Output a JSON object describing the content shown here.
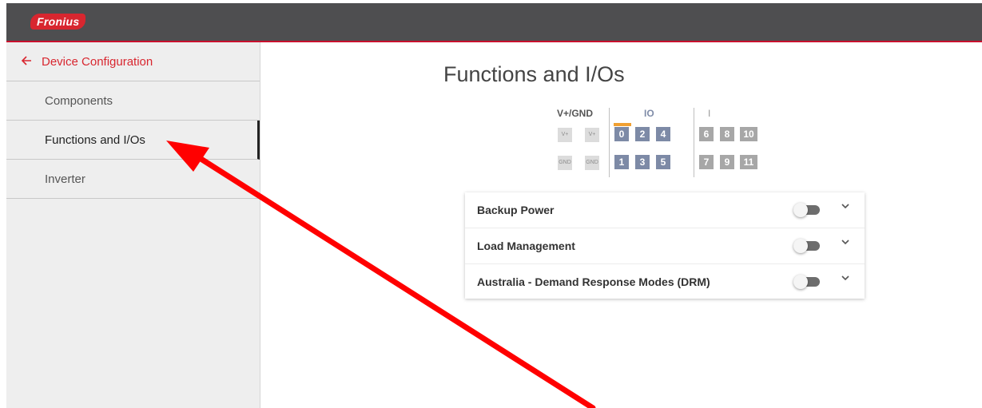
{
  "header": {
    "logo_text": "Fronius"
  },
  "sidebar": {
    "back_label": "Device Configuration",
    "items": [
      {
        "label": "Components",
        "active": false
      },
      {
        "label": "Functions and I/Os",
        "active": true
      },
      {
        "label": "Inverter",
        "active": false
      }
    ]
  },
  "main": {
    "title": "Functions and I/Os",
    "io_diagram": {
      "headers": {
        "power": "V+/GND",
        "io": "IO",
        "input": "I"
      },
      "vplus_labels": [
        "V+",
        "V+"
      ],
      "gnd_labels": [
        "GND",
        "GND"
      ],
      "io_top": [
        "0",
        "2",
        "4"
      ],
      "io_bottom": [
        "1",
        "3",
        "5"
      ],
      "input_top": [
        "6",
        "8",
        "10"
      ],
      "input_bottom": [
        "7",
        "9",
        "11"
      ]
    },
    "functions": [
      {
        "label": "Backup Power",
        "enabled": false
      },
      {
        "label": "Load Management",
        "enabled": false
      },
      {
        "label": "Australia - Demand Response Modes (DRM)",
        "enabled": false
      }
    ]
  },
  "colors": {
    "accent": "#d8262f",
    "header_bg": "#4e4e50",
    "io_pin": "#7d8aa6",
    "input_pin": "#a7a7a7",
    "indicator": "#f0a032",
    "annotation_arrow": "#ff0000"
  },
  "icons": {
    "back": "arrow-left-icon",
    "expand": "chevron-down-icon",
    "annotation": "red-pointer-arrow"
  }
}
